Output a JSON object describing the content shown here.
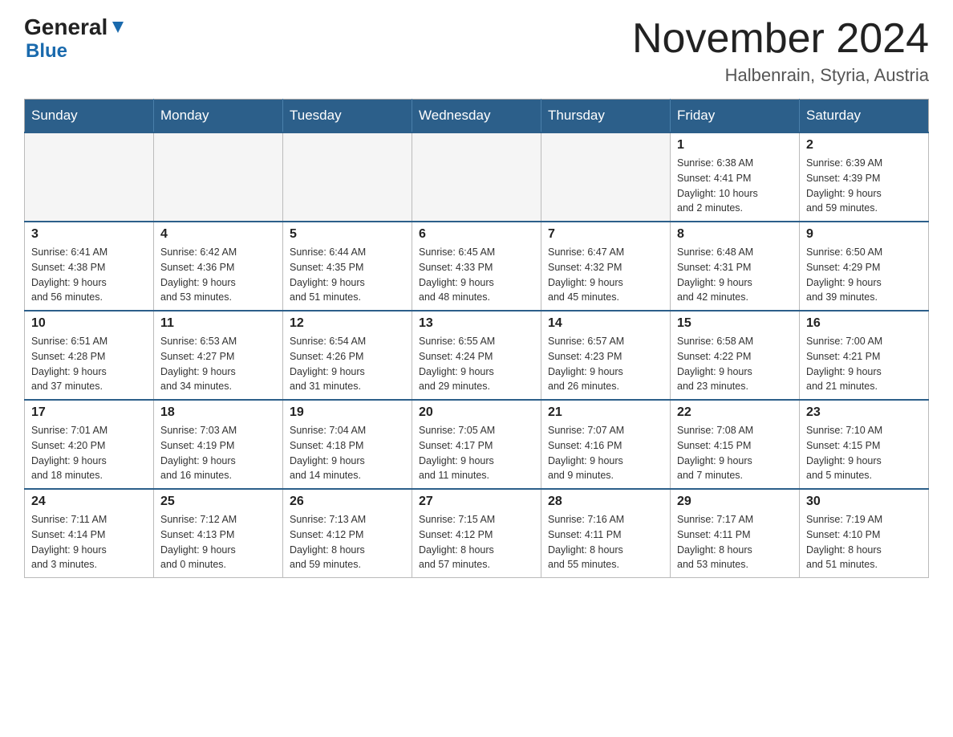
{
  "header": {
    "logo_general": "General",
    "logo_blue": "Blue",
    "title": "November 2024",
    "subtitle": "Halbenrain, Styria, Austria"
  },
  "days_of_week": [
    "Sunday",
    "Monday",
    "Tuesday",
    "Wednesday",
    "Thursday",
    "Friday",
    "Saturday"
  ],
  "weeks": [
    [
      {
        "day": "",
        "info": "",
        "empty": true
      },
      {
        "day": "",
        "info": "",
        "empty": true
      },
      {
        "day": "",
        "info": "",
        "empty": true
      },
      {
        "day": "",
        "info": "",
        "empty": true
      },
      {
        "day": "",
        "info": "",
        "empty": true
      },
      {
        "day": "1",
        "info": "Sunrise: 6:38 AM\nSunset: 4:41 PM\nDaylight: 10 hours\nand 2 minutes."
      },
      {
        "day": "2",
        "info": "Sunrise: 6:39 AM\nSunset: 4:39 PM\nDaylight: 9 hours\nand 59 minutes."
      }
    ],
    [
      {
        "day": "3",
        "info": "Sunrise: 6:41 AM\nSunset: 4:38 PM\nDaylight: 9 hours\nand 56 minutes."
      },
      {
        "day": "4",
        "info": "Sunrise: 6:42 AM\nSunset: 4:36 PM\nDaylight: 9 hours\nand 53 minutes."
      },
      {
        "day": "5",
        "info": "Sunrise: 6:44 AM\nSunset: 4:35 PM\nDaylight: 9 hours\nand 51 minutes."
      },
      {
        "day": "6",
        "info": "Sunrise: 6:45 AM\nSunset: 4:33 PM\nDaylight: 9 hours\nand 48 minutes."
      },
      {
        "day": "7",
        "info": "Sunrise: 6:47 AM\nSunset: 4:32 PM\nDaylight: 9 hours\nand 45 minutes."
      },
      {
        "day": "8",
        "info": "Sunrise: 6:48 AM\nSunset: 4:31 PM\nDaylight: 9 hours\nand 42 minutes."
      },
      {
        "day": "9",
        "info": "Sunrise: 6:50 AM\nSunset: 4:29 PM\nDaylight: 9 hours\nand 39 minutes."
      }
    ],
    [
      {
        "day": "10",
        "info": "Sunrise: 6:51 AM\nSunset: 4:28 PM\nDaylight: 9 hours\nand 37 minutes."
      },
      {
        "day": "11",
        "info": "Sunrise: 6:53 AM\nSunset: 4:27 PM\nDaylight: 9 hours\nand 34 minutes."
      },
      {
        "day": "12",
        "info": "Sunrise: 6:54 AM\nSunset: 4:26 PM\nDaylight: 9 hours\nand 31 minutes."
      },
      {
        "day": "13",
        "info": "Sunrise: 6:55 AM\nSunset: 4:24 PM\nDaylight: 9 hours\nand 29 minutes."
      },
      {
        "day": "14",
        "info": "Sunrise: 6:57 AM\nSunset: 4:23 PM\nDaylight: 9 hours\nand 26 minutes."
      },
      {
        "day": "15",
        "info": "Sunrise: 6:58 AM\nSunset: 4:22 PM\nDaylight: 9 hours\nand 23 minutes."
      },
      {
        "day": "16",
        "info": "Sunrise: 7:00 AM\nSunset: 4:21 PM\nDaylight: 9 hours\nand 21 minutes."
      }
    ],
    [
      {
        "day": "17",
        "info": "Sunrise: 7:01 AM\nSunset: 4:20 PM\nDaylight: 9 hours\nand 18 minutes."
      },
      {
        "day": "18",
        "info": "Sunrise: 7:03 AM\nSunset: 4:19 PM\nDaylight: 9 hours\nand 16 minutes."
      },
      {
        "day": "19",
        "info": "Sunrise: 7:04 AM\nSunset: 4:18 PM\nDaylight: 9 hours\nand 14 minutes."
      },
      {
        "day": "20",
        "info": "Sunrise: 7:05 AM\nSunset: 4:17 PM\nDaylight: 9 hours\nand 11 minutes."
      },
      {
        "day": "21",
        "info": "Sunrise: 7:07 AM\nSunset: 4:16 PM\nDaylight: 9 hours\nand 9 minutes."
      },
      {
        "day": "22",
        "info": "Sunrise: 7:08 AM\nSunset: 4:15 PM\nDaylight: 9 hours\nand 7 minutes."
      },
      {
        "day": "23",
        "info": "Sunrise: 7:10 AM\nSunset: 4:15 PM\nDaylight: 9 hours\nand 5 minutes."
      }
    ],
    [
      {
        "day": "24",
        "info": "Sunrise: 7:11 AM\nSunset: 4:14 PM\nDaylight: 9 hours\nand 3 minutes."
      },
      {
        "day": "25",
        "info": "Sunrise: 7:12 AM\nSunset: 4:13 PM\nDaylight: 9 hours\nand 0 minutes."
      },
      {
        "day": "26",
        "info": "Sunrise: 7:13 AM\nSunset: 4:12 PM\nDaylight: 8 hours\nand 59 minutes."
      },
      {
        "day": "27",
        "info": "Sunrise: 7:15 AM\nSunset: 4:12 PM\nDaylight: 8 hours\nand 57 minutes."
      },
      {
        "day": "28",
        "info": "Sunrise: 7:16 AM\nSunset: 4:11 PM\nDaylight: 8 hours\nand 55 minutes."
      },
      {
        "day": "29",
        "info": "Sunrise: 7:17 AM\nSunset: 4:11 PM\nDaylight: 8 hours\nand 53 minutes."
      },
      {
        "day": "30",
        "info": "Sunrise: 7:19 AM\nSunset: 4:10 PM\nDaylight: 8 hours\nand 51 minutes."
      }
    ]
  ]
}
